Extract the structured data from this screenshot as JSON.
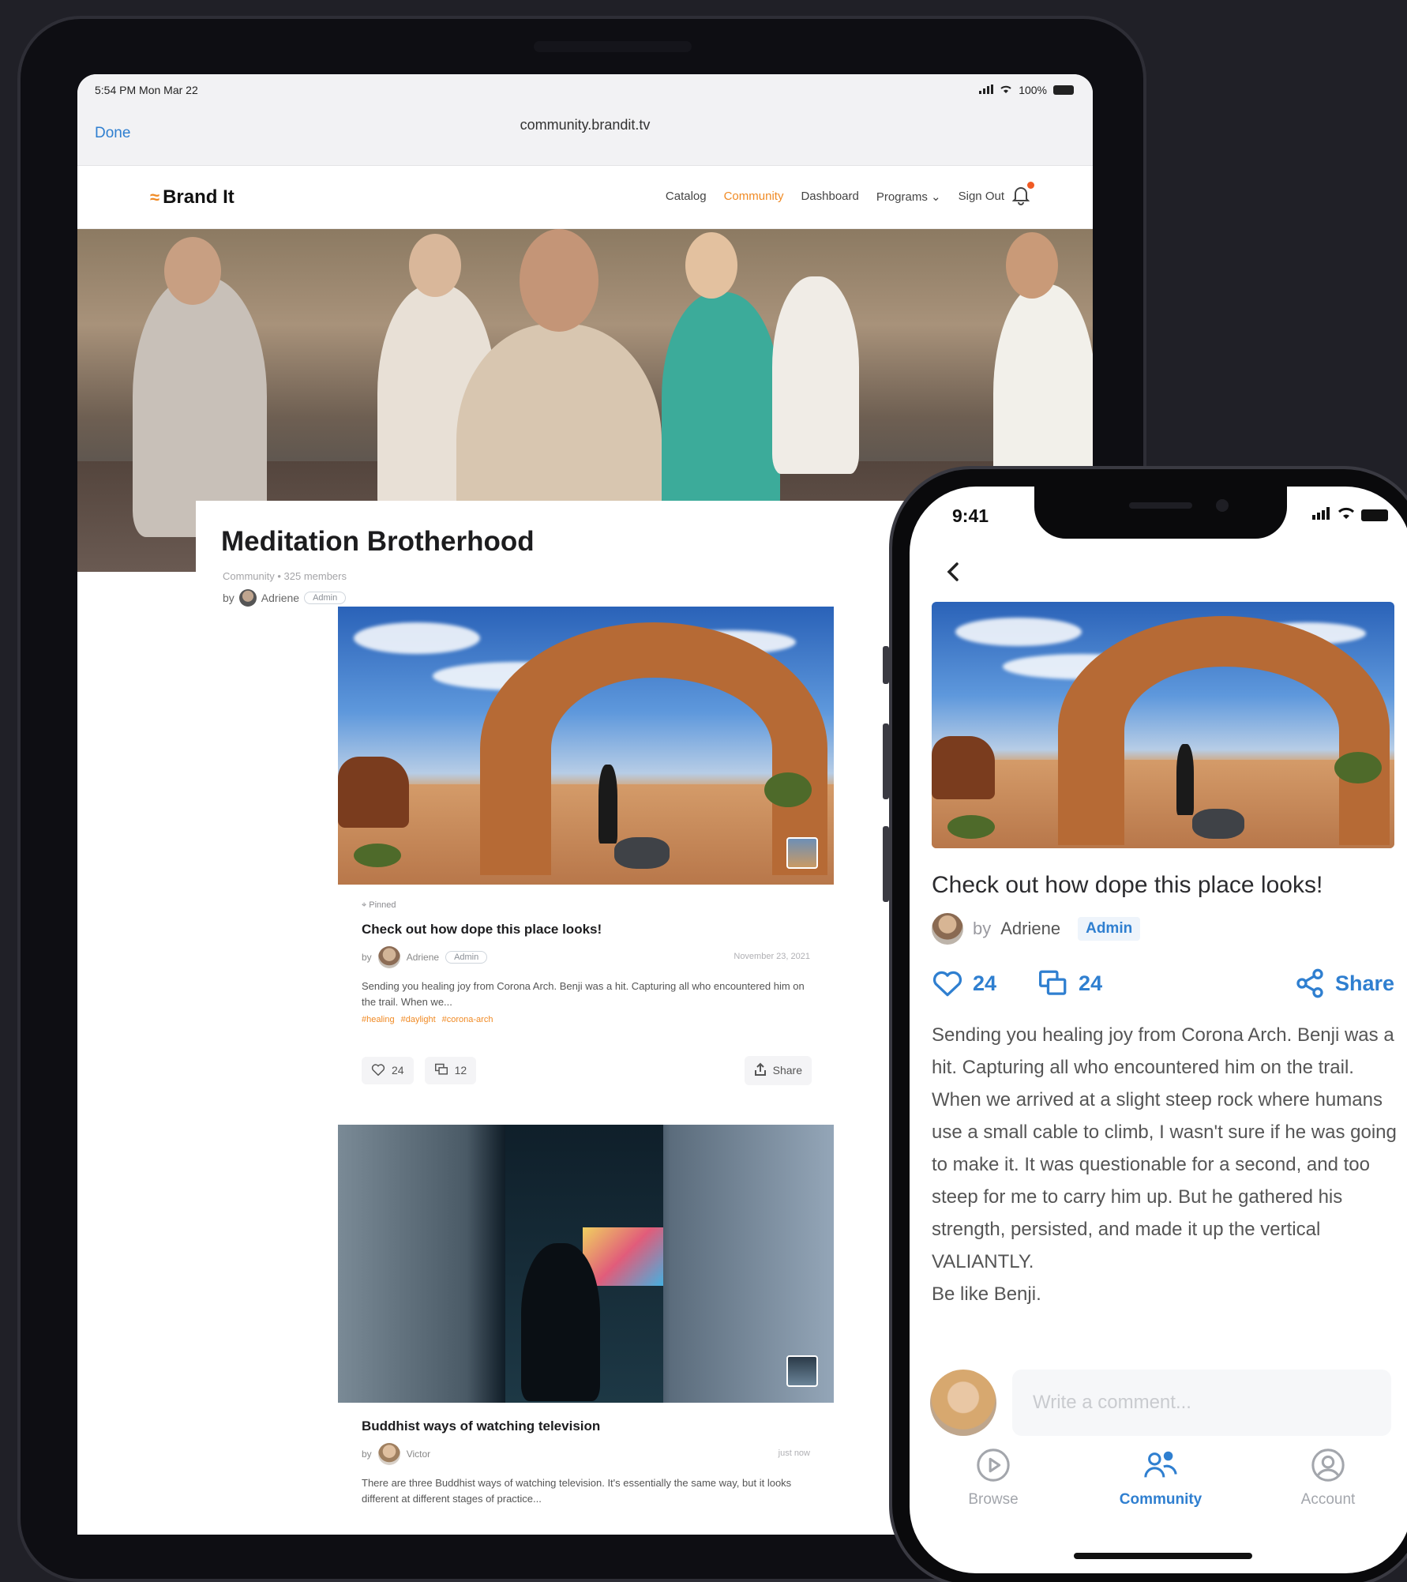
{
  "tablet": {
    "status": {
      "time": "5:54 PM  Mon Mar 22",
      "battery": "100%"
    },
    "browser": {
      "done": "Done",
      "url": "community.brandit.tv"
    },
    "nav": {
      "logo": "Brand It",
      "links": [
        "Catalog",
        "Community",
        "Dashboard",
        "Programs",
        "Sign Out"
      ],
      "active_link": "Community"
    },
    "community": {
      "title": "Meditation Brotherhood",
      "meta": "Community • 325 members",
      "by": "by",
      "author": "Adriene",
      "role": "Admin"
    },
    "posts": [
      {
        "pinned": "Pinned",
        "title": "Check out how dope this place looks!",
        "by": "by",
        "author": "Adriene",
        "role": "Admin",
        "date": "November 23, 2021",
        "excerpt": "Sending you healing joy from Corona Arch. Benji was a hit. Capturing all who encountered him on the trail. When we...",
        "tags": [
          "#healing",
          "#daylight",
          "#corona-arch"
        ],
        "likes": "24",
        "comments": "12",
        "share": "Share"
      },
      {
        "title": "Buddhist ways of watching television",
        "by": "by",
        "author": "Victor",
        "date": "just now",
        "excerpt": "There are three Buddhist ways of watching television. It's essentially the same way, but it looks different at different stages of practice..."
      }
    ]
  },
  "phone": {
    "status": {
      "time": "9:41"
    },
    "post": {
      "title": "Check out how dope this place looks!",
      "by": "by",
      "author": "Adriene",
      "role": "Admin",
      "likes": "24",
      "comments": "24",
      "share": "Share",
      "body": "Sending you healing joy from Corona Arch. Benji was a hit. Capturing all who encountered him on the trail. When we arrived at a slight steep rock where humans use a small cable to climb, I wasn't sure if he was going to make it. It was questionable for a second, and too steep for me to carry him up. But he gathered his strength, persisted, and made it up the vertical VALIANTLY.",
      "body_end": "Be like Benji.",
      "comment_placeholder": "Write a comment..."
    },
    "tabs": [
      {
        "label": "Browse",
        "icon": "play-circle-icon"
      },
      {
        "label": "Community",
        "icon": "people-icon"
      },
      {
        "label": "Account",
        "icon": "user-circle-icon"
      }
    ],
    "active_tab": "Community"
  },
  "colors": {
    "accent_orange": "#f08a24",
    "accent_blue": "#2f7fd0",
    "background": "#202027"
  }
}
